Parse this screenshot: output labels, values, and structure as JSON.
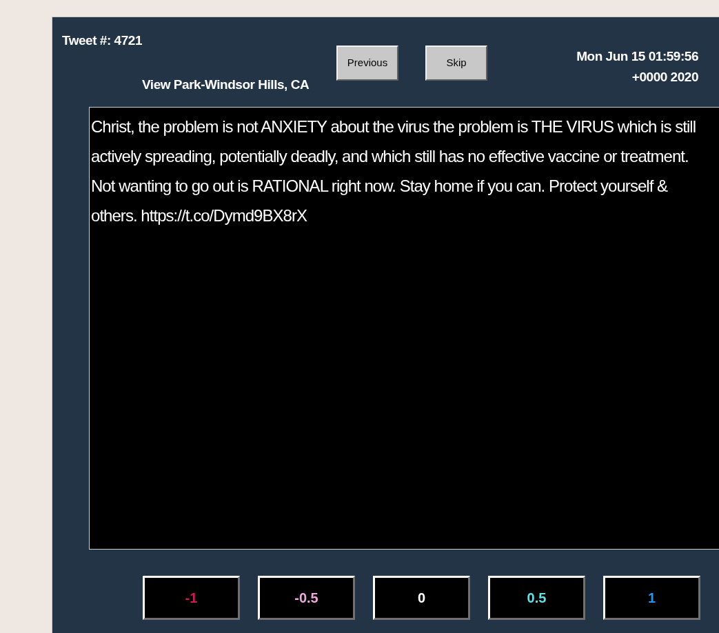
{
  "header": {
    "tweet_number": "Tweet #: 4721",
    "location": "View Park-Windsor Hills, CA",
    "timestamp_line_1": "Mon Jun 15 01:59:56",
    "timestamp_line_2": "+0000 2020"
  },
  "nav_buttons": [
    "Previous",
    "Skip"
  ],
  "tweet_text": "Christ, the problem is not ANXIETY about the virus the problem is THE VIRUS which is still actively spreading, potentially deadly, and which still has no effective vaccine or treatment. Not wanting to go out is RATIONAL right now. Stay home if you can. Protect yourself & others. https://t.co/Dymd9BX8rX",
  "rating_buttons": [
    {
      "label": "-1",
      "color": "#d0185a"
    },
    {
      "label": "-0.5",
      "color": "#f0a8e0"
    },
    {
      "label": "0",
      "color": "#ffffff"
    },
    {
      "label": "0.5",
      "color": "#60e0e8"
    },
    {
      "label": "1",
      "color": "#2196f3"
    }
  ]
}
